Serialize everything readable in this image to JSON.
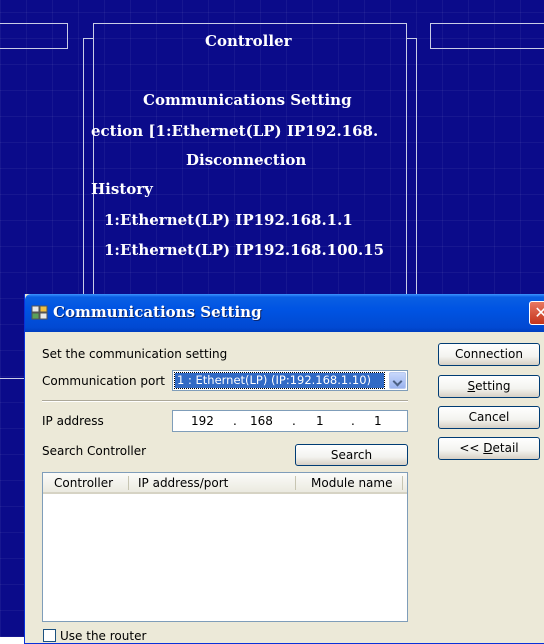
{
  "background": {
    "panel_title": "Controller",
    "panel_heading": "Communications Setting",
    "connection_line": "ection [1:Ethernet(LP) IP192.168.",
    "disconnection": "Disconnection",
    "history_label": "History",
    "history": [
      "1:Ethernet(LP) IP192.168.1.1",
      "1:Ethernet(LP) IP192.168.100.15"
    ]
  },
  "dialog": {
    "title": "Communications Setting",
    "close_glyph": "✕",
    "instruction": "Set the communication setting",
    "comm_port_label": "Communication port",
    "comm_port_value": "1 : Ethernet(LP) (IP:192.168.1.10)",
    "ip_label": "IP address",
    "ip_octets": [
      "192",
      "168",
      "1",
      "1"
    ],
    "search_label": "Search Controller",
    "search_button": "Search",
    "table_headers": [
      "Controller",
      "IP address/port",
      "Module name"
    ],
    "router_label": "Use the router",
    "buttons": {
      "connection": "Connection",
      "setting_u": "S",
      "setting_rest": "etting",
      "cancel": "Cancel",
      "detail_pre": "<< ",
      "detail_u": "D",
      "detail_rest": "etail"
    }
  }
}
